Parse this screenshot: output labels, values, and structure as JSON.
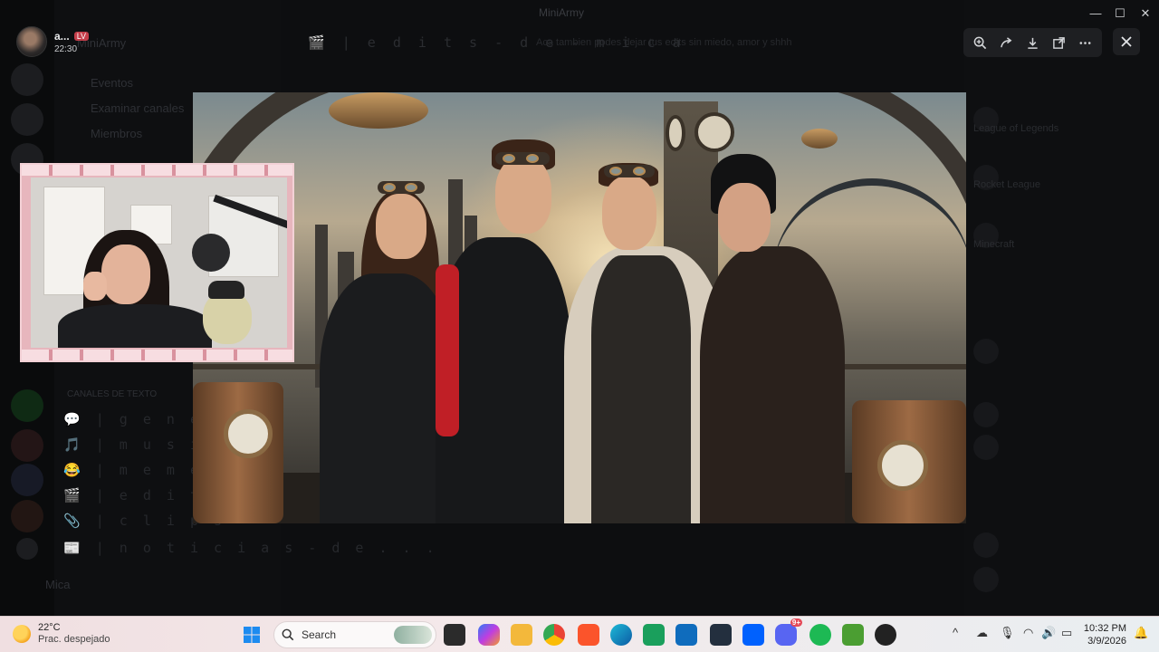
{
  "window": {
    "title": "MiniArmy",
    "controls": {
      "minimize": "—",
      "maximize": "☐",
      "close": "✕"
    }
  },
  "server": {
    "name": "MiniArmy"
  },
  "channel_header": {
    "name": "🎬 | e d i t s - d e - m i c a",
    "topic": "Aca tambien podes dejar tus edits sin miedo, amor y shhh"
  },
  "user": {
    "name": "a...",
    "badge": "LV",
    "time": "22:30"
  },
  "viewer_toolbar": {
    "zoom": "zoom-in-icon",
    "forward": "forward-icon",
    "download": "download-icon",
    "open": "open-external-icon",
    "more": "more-icon",
    "close": "close-icon"
  },
  "sidebar_dim": {
    "top_items": [
      "Eventos",
      "Examinar canales",
      "Miembros"
    ],
    "section_label": "CANALES DE TEXTO",
    "channels": [
      "💬 | g e n e r a l",
      "🎵 | m u s i c a",
      "😂 | m e m e s",
      "🎬 | e d i t s -",
      "📎 | c l i p s",
      "📰 | n o t i c i a s - d e . . ."
    ],
    "self_name": "Mica"
  },
  "members_dim": [
    {
      "name": "League of Legends"
    },
    {
      "name": "Rocket League"
    },
    {
      "name": "Minecraft"
    }
  ],
  "taskbar": {
    "weather_temp": "22°C",
    "weather_condition": "Prac. despejado",
    "search_label": "Search",
    "clock_time": "10:32 PM",
    "clock_date": "3/9/2026",
    "discord_badge": "9+"
  },
  "colors": {
    "taskbar_bg": "#f0dfe1",
    "viewer_bg": "#1e1f22",
    "badge_red": "#c43e4a",
    "webcam_frame": "#e7b6bd"
  }
}
